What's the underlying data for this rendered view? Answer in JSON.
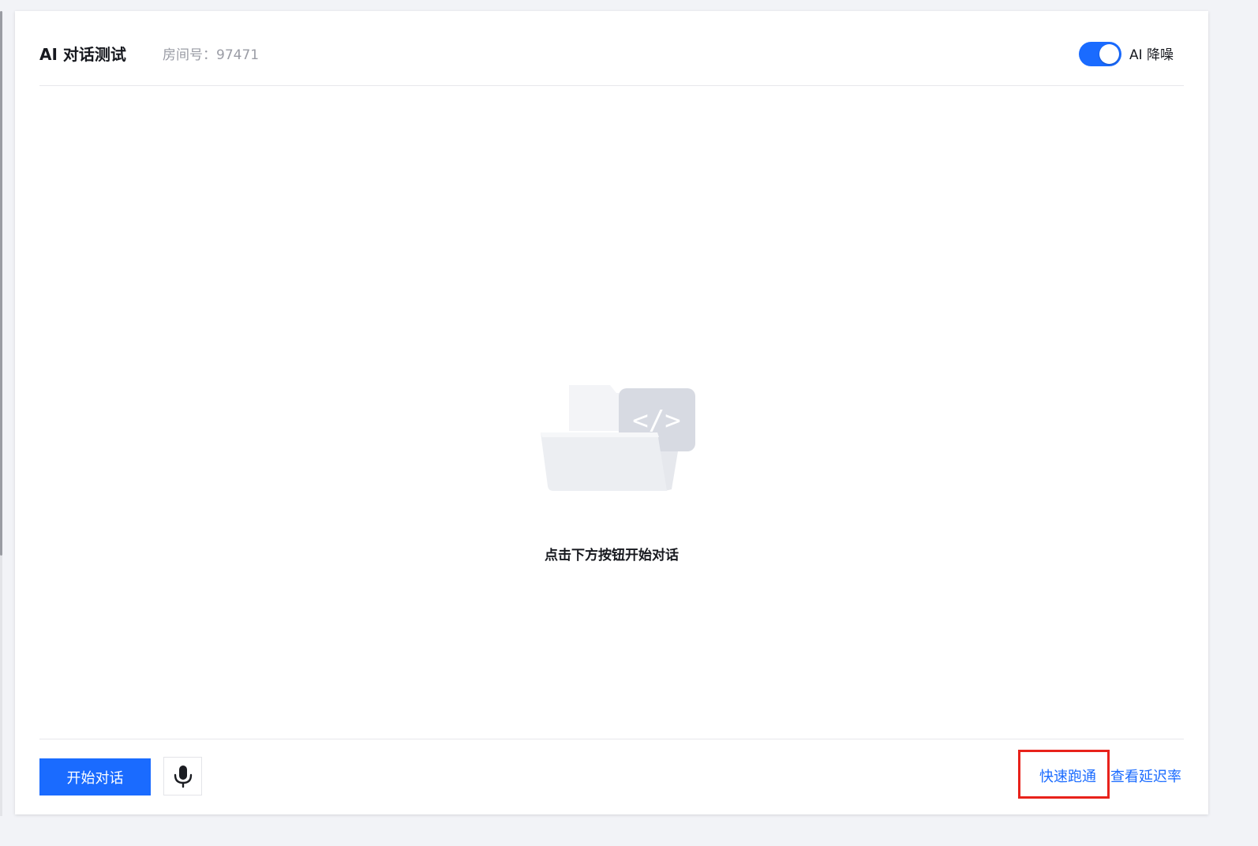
{
  "header": {
    "title": "AI 对话测试",
    "room_label": "房间号：",
    "room_number": "97471",
    "noise_reduction": {
      "label": "AI 降噪",
      "enabled": true
    }
  },
  "empty_state": {
    "icon": "code-folder-icon",
    "message": "点击下方按钮开始对话"
  },
  "footer": {
    "start_button_label": "开始对话",
    "mic_icon": "microphone-icon",
    "quick_start_link": "快速跑通",
    "latency_link": "查看延迟率"
  },
  "colors": {
    "accent": "#1a6bff",
    "highlight": "#e8221b",
    "background": "#f2f3f7"
  }
}
